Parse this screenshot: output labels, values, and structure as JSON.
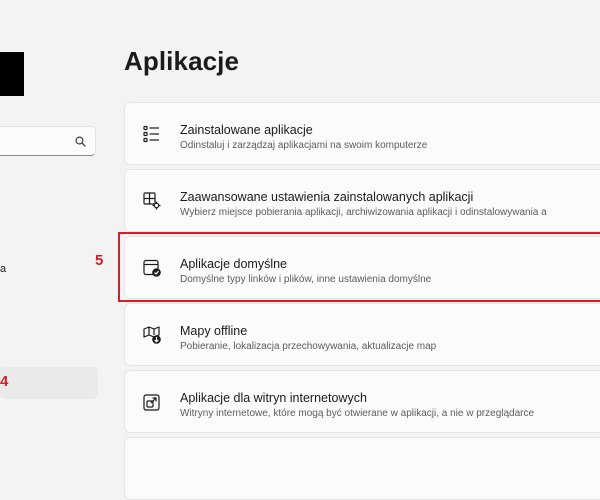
{
  "sidebar": {
    "search_placeholder": "",
    "nav_fragment": "a"
  },
  "annotations": {
    "step_4": "4",
    "step_5": "5"
  },
  "page": {
    "title": "Aplikacje"
  },
  "items": [
    {
      "icon": "installed-apps-list-icon",
      "title": "Zainstalowane aplikacje",
      "subtitle": "Odinstaluj i zarządzaj aplikacjami na swoim komputerze"
    },
    {
      "icon": "advanced-app-settings-icon",
      "title": "Zaawansowane ustawienia zainstalowanych aplikacji",
      "subtitle": "Wybierz miejsce pobierania aplikacji, archiwizowania aplikacji i odinstalowywania a"
    },
    {
      "icon": "default-apps-icon",
      "title": "Aplikacje domyślne",
      "subtitle": "Domyślne typy linków i plików, inne ustawienia domyślne"
    },
    {
      "icon": "offline-maps-icon",
      "title": "Mapy offline",
      "subtitle": "Pobieranie, lokalizacja przechowywania, aktualizacje map"
    },
    {
      "icon": "apps-for-websites-icon",
      "title": "Aplikacje dla witryn internetowych",
      "subtitle": "Witryny internetowe, które mogą być otwierane w aplikacji, a nie w przeglądarce"
    }
  ],
  "colors": {
    "background": "#f3f3f3",
    "card": "#fbfbfb",
    "annotation_red": "#d32027"
  }
}
